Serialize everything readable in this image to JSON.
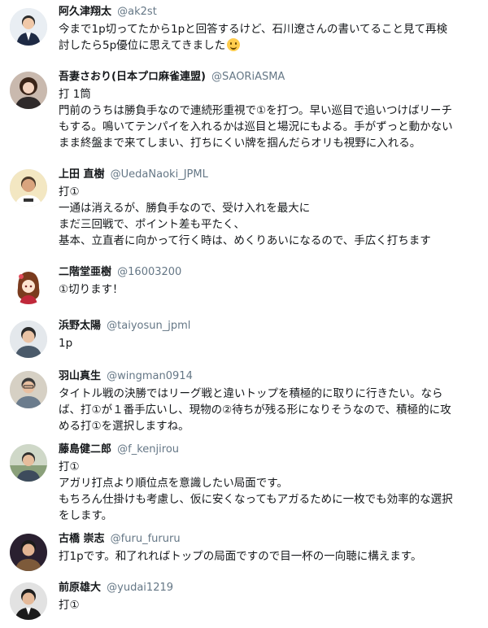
{
  "colors": {
    "name": "#14171a",
    "handle": "#657786",
    "emoji": "#ffcc4d"
  },
  "tweets": [
    {
      "name": "阿久津翔太",
      "handle": "@ak2st",
      "text": "今まで1p切ってたから1pと回答するけど、石川遼さんの書いてること見て再検\n討したら5p優位に思えてきました",
      "emoji": "smiling-face-emoji"
    },
    {
      "name": "吾妻さおり(日本プロ麻雀連盟)",
      "handle": "@SAORiASMA",
      "text": "打 1筒\n門前のうちは勝負手なので連続形重視で①を打つ。早い巡目で追いつけばリーチ\nもする。鳴いてテンパイを入れるかは巡目と場況にもよる。手がずっと動かない\nまま終盤まで来てしまい、打ちにくい牌を掴んだらオリも視野に入れる。"
    },
    {
      "name": "上田 直樹",
      "handle": "@UedaNaoki_JPML",
      "text": "打①\n一通は消えるが、勝負手なので、受け入れを最大に\nまだ三回戦で、ポイント差も平たく、\n基本、立直者に向かって行く時は、めくりあいになるので、手広く打ちます"
    },
    {
      "name": "二階堂亜樹",
      "handle": "@16003200",
      "text": "①切ります！"
    },
    {
      "name": "浜野太陽",
      "handle": "@taiyosun_jpml",
      "text": "1p"
    },
    {
      "name": "羽山真生",
      "handle": "@wingman0914",
      "text": "タイトル戦の決勝ではリーグ戦と違いトップを積極的に取りに行きたい。なら\nば、打①が１番手広いし、現物の②待ちが残る形になりそうなので、積極的に攻\nめる打①を選択しますね。"
    },
    {
      "name": "藤島健二郎",
      "handle": "@f_kenjirou",
      "text": "打①\nアガリ打点より順位点を意識したい局面です。\nもちろん仕掛けも考慮し、仮に安くなってもアガるために一枚でも効率的な選択\nをします。"
    },
    {
      "name": "古橋 崇志",
      "handle": "@furu_fururu",
      "text": "打1pです。和了れればトップの局面ですので目一杯の一向聴に構えます。"
    },
    {
      "name": "前原雄大",
      "handle": "@yudai1219",
      "text": "打①"
    }
  ]
}
